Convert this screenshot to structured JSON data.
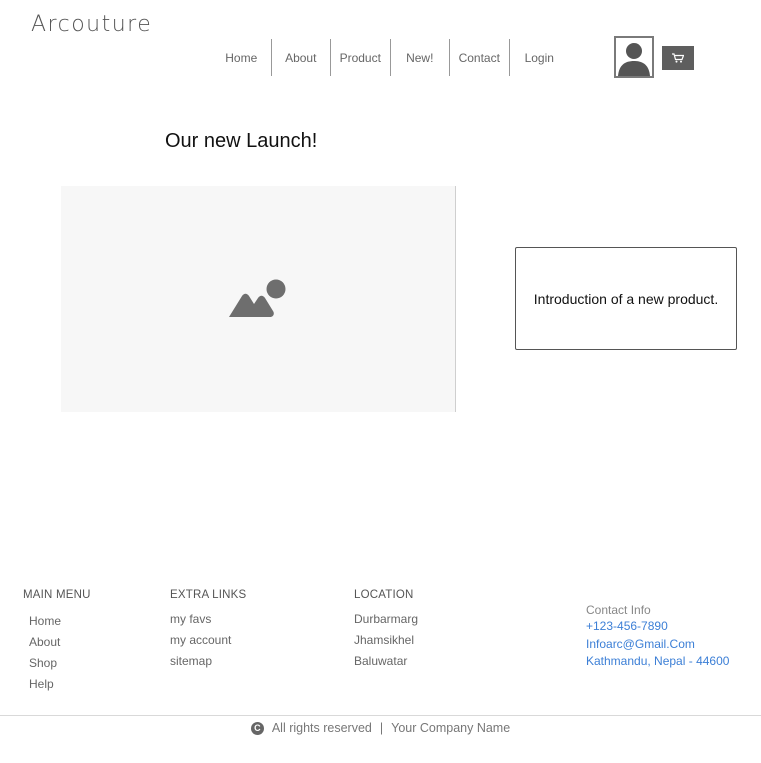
{
  "brand": "Arcouture",
  "nav": [
    "Home",
    "About",
    "Product",
    "New!",
    "Contact",
    "Login"
  ],
  "header_icons": {
    "avatar": "user-avatar-icon",
    "cart": "shopping-cart-icon"
  },
  "launch": {
    "title": "Our new Launch!",
    "image_icon": "image-placeholder-icon",
    "intro": "Introduction of a new product."
  },
  "footer": {
    "main_menu": {
      "heading": "MAIN MENU",
      "links": [
        "Home",
        "About",
        "Shop",
        "Help"
      ]
    },
    "extra_links": {
      "heading": "EXTRA LINKS",
      "links": [
        "my favs",
        "my account",
        "sitemap"
      ]
    },
    "location": {
      "heading": "LOCATION",
      "links": [
        "Durbarmarg",
        "Jhamsikhel",
        "Baluwatar"
      ]
    },
    "contact": {
      "heading": "Contact Info",
      "phone": "+123-456-7890",
      "email": "Infoarc@Gmail.Com",
      "address": "Kathmandu, Nepal - 44600"
    },
    "copyright": {
      "icon": "copyright-icon",
      "text": "All rights reserved",
      "separator": "|",
      "company": "Your Company Name"
    }
  },
  "colors": {
    "link_blue": "#3c7fd6",
    "cart_bg": "#5e5e5e",
    "hero_bg": "#f7f7f7"
  }
}
